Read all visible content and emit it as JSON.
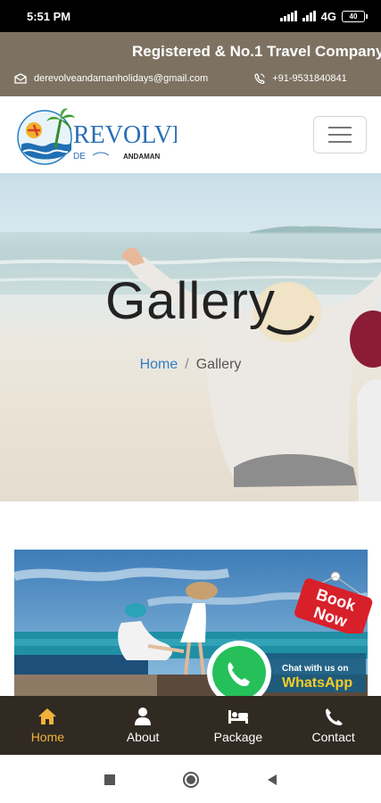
{
  "status_bar": {
    "time": "5:51 PM",
    "network": "4G",
    "battery": "40"
  },
  "topbar": {
    "tagline": "Registered & No.1 Travel Company",
    "email": "derevolveandamanholidays@gmail.com",
    "phone": "+91-9531840841",
    "email_icon": "envelope-icon",
    "phone_icon": "phone-icon"
  },
  "brand": {
    "name": "REVOLVE",
    "prefix": "DE",
    "suffix": "ANDAMAN"
  },
  "hero": {
    "title": "Gallery",
    "breadcrumb": {
      "home": "Home",
      "separator": "/",
      "current": "Gallery"
    }
  },
  "promo": {
    "book_line1": "Book",
    "book_line2": "Now",
    "whatsapp_line1": "Chat with us on",
    "whatsapp_line2": "WhatsApp"
  },
  "bottom_nav": {
    "items": [
      {
        "label": "Home",
        "icon": "home-icon",
        "active": true
      },
      {
        "label": "About",
        "icon": "user-icon",
        "active": false
      },
      {
        "label": "Package",
        "icon": "bed-icon",
        "active": false
      },
      {
        "label": "Contact",
        "icon": "phone-icon",
        "active": false
      }
    ]
  },
  "colors": {
    "topbar": "#7d7262",
    "bottom_nav": "#302a22",
    "active_nav": "#f2b33a",
    "breadcrumb_link": "#2f7ec7"
  }
}
